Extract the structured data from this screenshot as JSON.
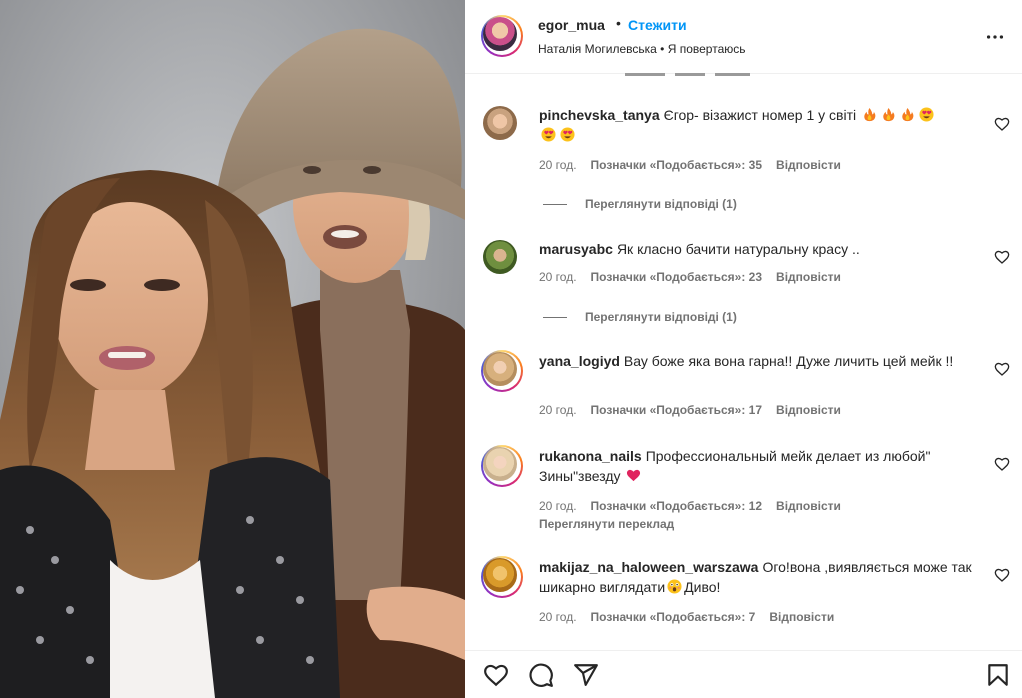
{
  "post": {
    "username": "egor_mua",
    "separator": "•",
    "follow_label": "Стежити",
    "subtitle": "Наталія Могилевська • Я повертаюсь",
    "more_icon": "more-horizontal-icon"
  },
  "comments": [
    {
      "username": "pinchevska_tanya",
      "text": "Єгор- візажист номер 1 у світі",
      "emojis": [
        "fire",
        "fire",
        "fire",
        "heart-eyes",
        "heart-eyes",
        "heart-eyes"
      ],
      "time": "20 год.",
      "likes": "Позначки «Подобається»: 35",
      "reply": "Відповісти",
      "view_replies": "Переглянути відповіді (1)"
    },
    {
      "username": "marusyabc",
      "text": "Як класно бачити натуральну красу ..",
      "time": "20 год.",
      "likes": "Позначки «Подобається»: 23",
      "reply": "Відповісти",
      "view_replies": "Переглянути відповіді (1)"
    },
    {
      "username": "yana_logiyd",
      "text": "Вау боже яка вона гарна!! Дуже личить цей мейк !!",
      "time": "20 год.",
      "likes": "Позначки «Подобається»: 17",
      "reply": "Відповісти"
    },
    {
      "username": "rukanona_nails",
      "text": "Профессиональный мейк делает из любой\" Зины\"звезду",
      "emojis": [
        "red-heart"
      ],
      "time": "20 год.",
      "likes": "Позначки «Подобається»: 12",
      "reply": "Відповісти",
      "translate": "Переглянути переклад"
    },
    {
      "username": "makijaz_na_haloween_warszawa",
      "text_before": "Ого!вона ,виявляється може так шикарно виглядати",
      "text_after": "Диво!",
      "emojis": [
        "astonished"
      ],
      "time": "20 год.",
      "likes": "Позначки «Подобається»: 7",
      "reply": "Відповісти"
    }
  ],
  "actions": {
    "like_icon": "heart-icon",
    "comment_icon": "comment-icon",
    "share_icon": "send-icon",
    "save_icon": "bookmark-icon"
  },
  "colors": {
    "accent": "#0095f6",
    "text": "#262626",
    "muted": "#737373",
    "heart_red": "#e0245e"
  }
}
